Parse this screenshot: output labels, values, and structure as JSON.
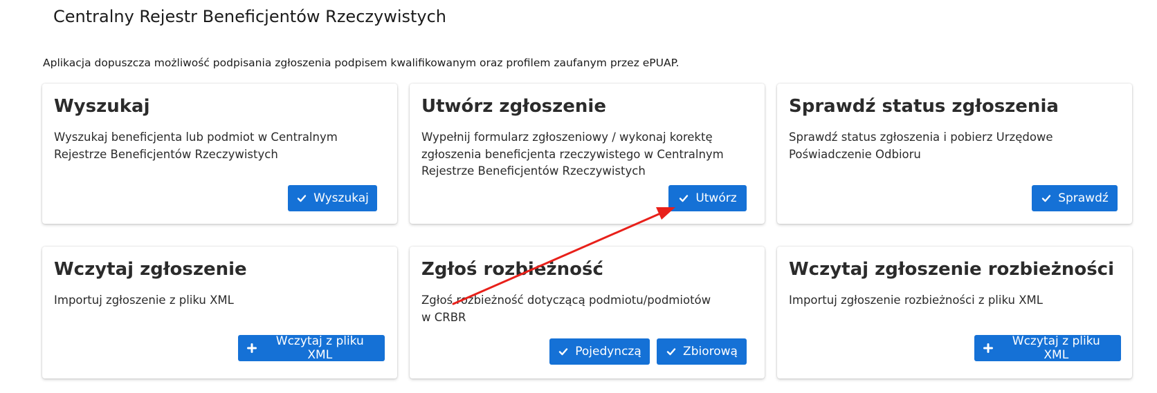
{
  "header": {
    "title": "Centralny Rejestr Beneficjentów Rzeczywistych"
  },
  "intro": "Aplikacja dopuszcza możliwość podpisania zgłoszenia podpisem kwalifikowanym oraz profilem zaufanym przez ePUAP.",
  "cards": [
    {
      "title": "Wyszukaj",
      "description": "Wyszukaj beneficjenta lub podmiot w Centralnym Rejestrze Beneficjentów Rzeczywistych",
      "buttons": [
        {
          "label": "Wyszukaj",
          "icon": "check-icon"
        }
      ]
    },
    {
      "title": "Utwórz zgłoszenie",
      "description": "Wypełnij formularz zgłoszeniowy / wykonaj korektę zgłoszenia beneficjenta rzeczywistego w Centralnym Rejestrze Beneficjentów Rzeczywistych",
      "buttons": [
        {
          "label": "Utwórz",
          "icon": "check-icon"
        }
      ]
    },
    {
      "title": "Sprawdź status zgłoszenia",
      "description": "Sprawdź status zgłoszenia i pobierz Urzędowe Poświadczenie Odbioru",
      "buttons": [
        {
          "label": "Sprawdź",
          "icon": "check-icon"
        }
      ]
    },
    {
      "title": "Wczytaj zgłoszenie",
      "description": "Importuj zgłoszenie z pliku XML",
      "buttons": [
        {
          "label": "Wczytaj z pliku XML",
          "icon": "plus-icon"
        }
      ]
    },
    {
      "title": "Zgłoś rozbieżność",
      "description": "Zgłoś rozbieżność dotyczącą podmiotu/podmiotów w CRBR",
      "buttons": [
        {
          "label": "Pojedynczą",
          "icon": "check-icon"
        },
        {
          "label": "Zbiorową",
          "icon": "check-icon"
        }
      ]
    },
    {
      "title": "Wczytaj zgłoszenie rozbieżności",
      "description": "Importuj zgłoszenie rozbieżności z pliku XML",
      "buttons": [
        {
          "label": "Wczytaj z pliku XML",
          "icon": "plus-icon"
        }
      ]
    }
  ],
  "colors": {
    "button": "#1571d6",
    "annotation_arrow": "#e8201a"
  }
}
